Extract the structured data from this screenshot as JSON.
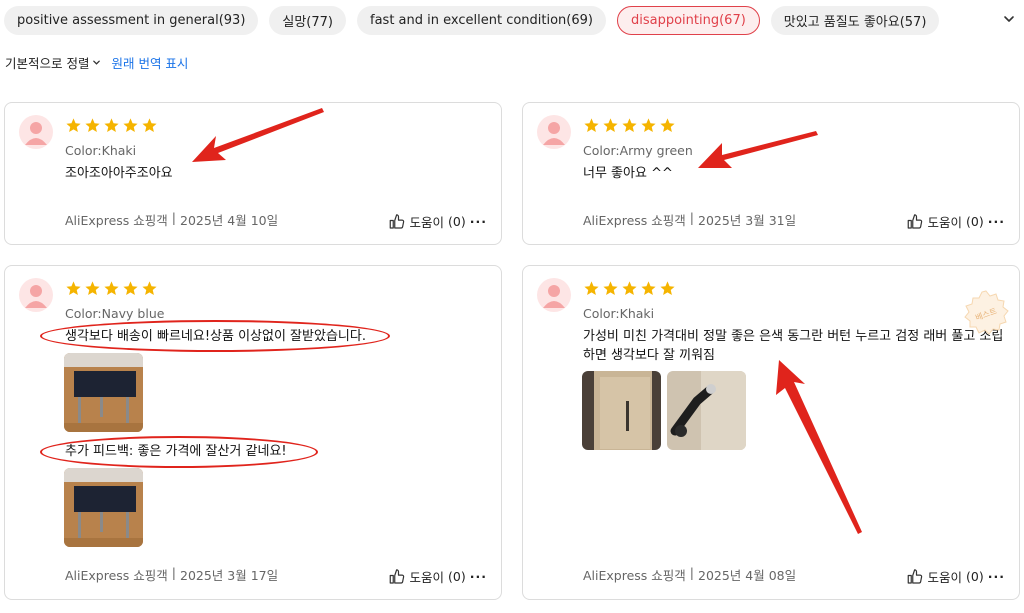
{
  "filters": [
    {
      "label": "positive assessment in general(93)",
      "active": false
    },
    {
      "label": "실망(77)",
      "active": false
    },
    {
      "label": "fast and in excellent condition(69)",
      "active": false
    },
    {
      "label": "disappointing(67)",
      "active": true
    },
    {
      "label": "맛있고 품질도 좋아요(57)",
      "active": false
    }
  ],
  "sort": {
    "label": "기본적으로 정렬",
    "translate_label": "원래 번역 표시"
  },
  "colors": {
    "accent": "#e0414a",
    "star": "#f5b400",
    "link": "#1a73e8",
    "annotation": "#e0241c"
  },
  "reviews": [
    {
      "rating": 5,
      "color": "Color:Khaki",
      "text": "조아조아아주조아요",
      "source": "AliExpress 쇼핑객",
      "date": "2025년 4월 10일",
      "helpful_label": "도움이",
      "helpful_count": "(0)"
    },
    {
      "rating": 5,
      "color": "Color:Army green",
      "text": "너무 좋아요 ^^",
      "source": "AliExpress 쇼핑객",
      "date": "2025년 3월 31일",
      "helpful_label": "도움이",
      "helpful_count": "(0)"
    },
    {
      "rating": 5,
      "color": "Color:Navy blue",
      "text": "생각보다 배송이 빠르네요!상품 이상없이 잘받았습니다.",
      "additional": "추가 피드백: 좋은 가격에 잘산거 같네요!",
      "source": "AliExpress 쇼핑객",
      "date": "2025년 3월 17일",
      "helpful_label": "도움이",
      "helpful_count": "(0)"
    },
    {
      "rating": 5,
      "color": "Color:Khaki",
      "text": "가성비 미친 가격대비 정말 좋은 은색 동그란 버턴 누르고 검정 래버 풀고 조립하면 생각보다 잘 끼워짐",
      "badge": "베스트",
      "source": "AliExpress 쇼핑객",
      "date": "2025년 4월 08일",
      "helpful_label": "도움이",
      "helpful_count": "(0)"
    }
  ]
}
